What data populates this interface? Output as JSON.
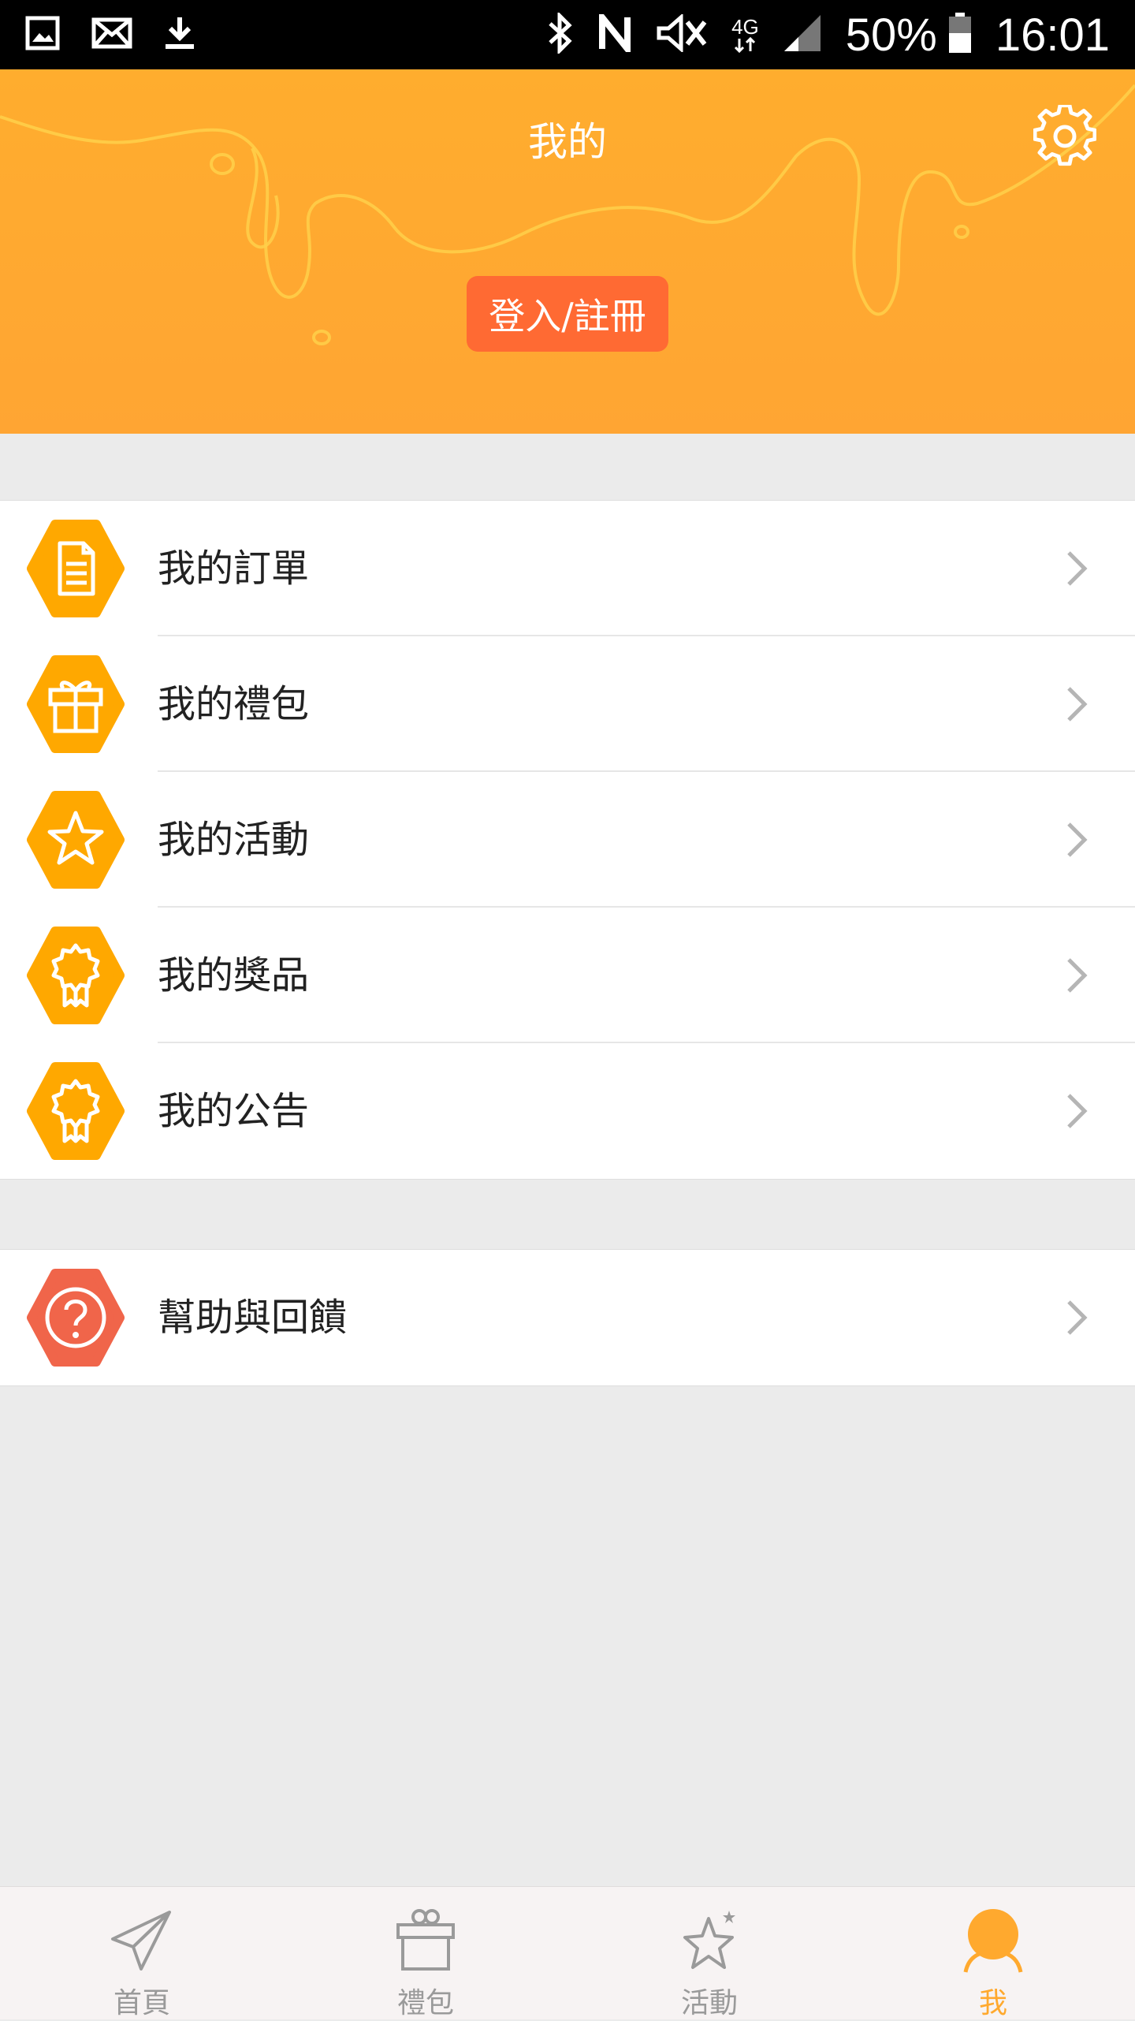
{
  "status_bar": {
    "battery": "50%",
    "time": "16:01",
    "network": "4G",
    "left_icons": [
      "gallery-icon",
      "mail-icon",
      "download-icon"
    ],
    "right_icons": [
      "bluetooth-icon",
      "nfc-icon",
      "mute-icon",
      "signal-icon",
      "battery-icon"
    ]
  },
  "header": {
    "title": "我的",
    "login_label": "登入/註冊",
    "settings_icon": "gear-icon",
    "background": "#ffa92e",
    "button_color": "#ff6a33"
  },
  "menu": {
    "items": [
      {
        "label": "我的訂單",
        "icon": "document-icon",
        "color": "#ffa800"
      },
      {
        "label": "我的禮包",
        "icon": "gift-icon",
        "color": "#ffa800"
      },
      {
        "label": "我的活動",
        "icon": "star-icon",
        "color": "#ffa800"
      },
      {
        "label": "我的獎品",
        "icon": "award-icon",
        "color": "#ffa800"
      },
      {
        "label": "我的公告",
        "icon": "award-icon",
        "color": "#ffa800"
      }
    ],
    "help": {
      "label": "幫助與回饋",
      "icon": "question-icon",
      "color": "#f0654a"
    }
  },
  "bottom_nav": {
    "items": [
      {
        "label": "首頁",
        "icon": "paper-plane-icon"
      },
      {
        "label": "禮包",
        "icon": "gift-box-icon"
      },
      {
        "label": "活動",
        "icon": "star-icon"
      },
      {
        "label": "我",
        "icon": "user-icon",
        "active": true
      }
    ],
    "active_color": "#ffa92e"
  }
}
